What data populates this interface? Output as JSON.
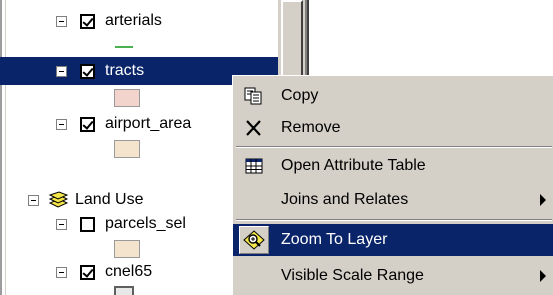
{
  "toc": {
    "items": [
      {
        "label": "arterials",
        "checked": true
      },
      {
        "label": "tracts",
        "checked": true,
        "selected": true
      },
      {
        "label": "airport_area",
        "checked": true
      },
      {
        "label": "Land Use",
        "group": true
      },
      {
        "label": "parcels_sel",
        "checked": false
      },
      {
        "label": "cnel65",
        "checked": true
      }
    ]
  },
  "colors": {
    "selection": "#0a246a",
    "arterials_line": "#4caf50",
    "tracts_fill": "#f2d4cc",
    "airport_fill": "#f5e4cd",
    "parcels_fill": "#f5e4cd"
  },
  "context_menu": {
    "items": [
      {
        "label": "Copy",
        "icon": "copy-icon"
      },
      {
        "label": "Remove",
        "icon": "remove-x-icon"
      },
      {
        "label": "Open Attribute Table",
        "icon": "table-icon"
      },
      {
        "label": "Joins and Relates",
        "submenu": true
      },
      {
        "label": "Zoom To Layer",
        "icon": "zoom-to-layer-icon",
        "highlighted": true
      },
      {
        "label": "Visible Scale Range",
        "submenu": true
      }
    ]
  }
}
